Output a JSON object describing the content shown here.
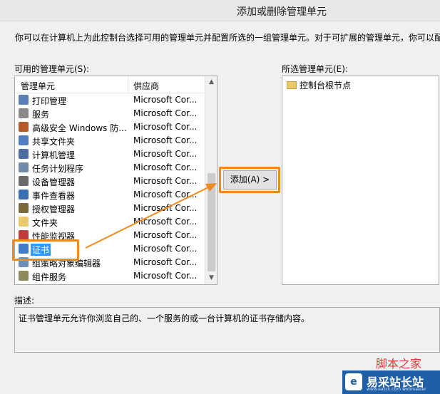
{
  "window": {
    "title": "添加或删除管理单元"
  },
  "intro_text": "你可以在计算机上为此控制台选择可用的管理单元并配置所选的一组管理单元。对于可扩展的管理单元，你可以配",
  "available": {
    "label": "可用的管理单元(S):",
    "columns": {
      "name": "管理单元",
      "vendor": "供应商"
    },
    "rows": [
      {
        "name": "打印管理",
        "vendor": "Microsoft Cor...",
        "icon": "printer-icon",
        "color": "#5a7fb5"
      },
      {
        "name": "服务",
        "vendor": "Microsoft Cor...",
        "icon": "gears-icon",
        "color": "#8a8a8a"
      },
      {
        "name": "高级安全 Windows 防...",
        "vendor": "Microsoft Cor...",
        "icon": "firewall-icon",
        "color": "#b55b2a"
      },
      {
        "name": "共享文件夹",
        "vendor": "Microsoft Cor...",
        "icon": "shared-folder-icon",
        "color": "#4f7fc0"
      },
      {
        "name": "计算机管理",
        "vendor": "Microsoft Cor...",
        "icon": "computer-management-icon",
        "color": "#4a6e9e"
      },
      {
        "name": "任务计划程序",
        "vendor": "Microsoft Cor...",
        "icon": "clock-icon",
        "color": "#6f8aa8"
      },
      {
        "name": "设备管理器",
        "vendor": "Microsoft Cor...",
        "icon": "device-manager-icon",
        "color": "#6a6a6a"
      },
      {
        "name": "事件查看器",
        "vendor": "Microsoft Cor...",
        "icon": "event-viewer-icon",
        "color": "#3b6fb3"
      },
      {
        "name": "授权管理器",
        "vendor": "Microsoft Cor...",
        "icon": "authorization-icon",
        "color": "#7a6a3a"
      },
      {
        "name": "文件夹",
        "vendor": "Microsoft Cor...",
        "icon": "folder-icon",
        "color": "#e9c96a"
      },
      {
        "name": "性能监视器",
        "vendor": "Microsoft Cor...",
        "icon": "performance-icon",
        "color": "#c23b3b"
      },
      {
        "name": "证书",
        "vendor": "Microsoft Cor...",
        "icon": "certificate-icon",
        "color": "#3f7cc9",
        "selected": true
      },
      {
        "name": "组策略对象编辑器",
        "vendor": "Microsoft Cor...",
        "icon": "policy-icon",
        "color": "#6a8fb8"
      },
      {
        "name": "组件服务",
        "vendor": "Microsoft Cor...",
        "icon": "component-services-icon",
        "color": "#8a8a5a"
      }
    ]
  },
  "add_button": {
    "label": "添加(A) >"
  },
  "selected_panel": {
    "label": "所选管理单元(E):",
    "items": [
      {
        "name": "控制台根节点",
        "icon": "folder-icon"
      }
    ]
  },
  "description": {
    "label": "描述:",
    "text": "证书管理单元允许你浏览自己的、一个服务的或一台计算机的证书存储内容。"
  },
  "watermark": {
    "brand": "易采站长站",
    "url": "www.easck.com webmaster",
    "red_text": "脚本之家",
    "logo_char": "e"
  },
  "colors": {
    "highlight": "#f08a1c",
    "selection": "#3399ff"
  }
}
